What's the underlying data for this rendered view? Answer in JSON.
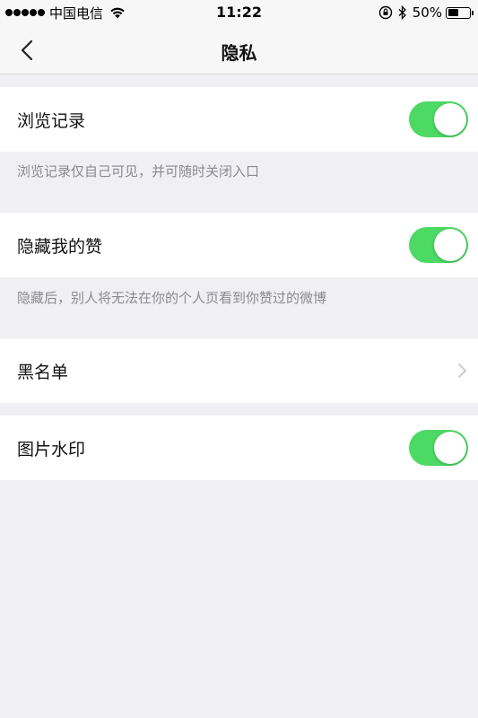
{
  "status_bar": {
    "carrier": "中国电信",
    "time": "11:22",
    "battery_percent": "50%",
    "battery_level": 0.5
  },
  "nav": {
    "title": "隐私",
    "back_icon": "chevron-left-icon"
  },
  "settings": {
    "browse_history": {
      "label": "浏览记录",
      "enabled": true,
      "hint": "浏览记录仅自己可见，并可随时关闭入口"
    },
    "hide_likes": {
      "label": "隐藏我的赞",
      "enabled": true,
      "hint": "隐藏后，别人将无法在你的个人页看到你赞过的微博"
    },
    "blacklist": {
      "label": "黑名单"
    },
    "watermark": {
      "label": "图片水印",
      "enabled": true
    }
  },
  "colors": {
    "toggle_on": "#4cd964",
    "background": "#efeff4",
    "hint_text": "#8a8a8f"
  }
}
